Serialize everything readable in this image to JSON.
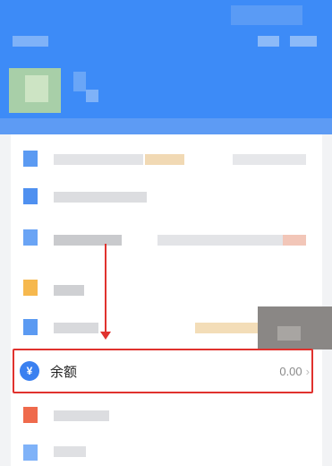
{
  "balance": {
    "label": "余额",
    "icon_symbol": "¥",
    "value": "0.00",
    "chevron": "›",
    "icon_color": "#3a80f0"
  },
  "annotation": {
    "color": "#e0322e"
  },
  "colors": {
    "header": "#3d8bf7",
    "background": "#f2f3f5"
  }
}
